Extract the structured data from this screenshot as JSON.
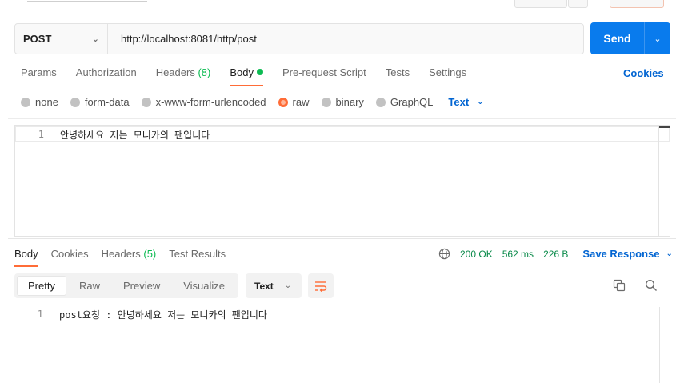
{
  "request": {
    "method": "POST",
    "url": "http://localhost:8081/http/post",
    "send_label": "Send"
  },
  "request_tabs": [
    {
      "label": "Params"
    },
    {
      "label": "Authorization"
    },
    {
      "label": "Headers",
      "count": "(8)"
    },
    {
      "label": "Body"
    },
    {
      "label": "Pre-request Script"
    },
    {
      "label": "Tests"
    },
    {
      "label": "Settings"
    }
  ],
  "cookies_link": "Cookies",
  "body_options": {
    "none": "none",
    "form_data": "form-data",
    "urlencoded": "x-www-form-urlencoded",
    "raw": "raw",
    "binary": "binary",
    "graphql": "GraphQL",
    "selected": "raw",
    "format": "Text"
  },
  "editor": {
    "line_number": "1",
    "content": "안녕하세요 저는 모니카의 팬입니다"
  },
  "response_tabs": {
    "body": "Body",
    "cookies": "Cookies",
    "headers": "Headers",
    "headers_count": "(5)",
    "test_results": "Test Results"
  },
  "response_meta": {
    "status": "200 OK",
    "time": "562 ms",
    "size": "226 B",
    "save_label": "Save Response"
  },
  "view_modes": {
    "pretty": "Pretty",
    "raw": "Raw",
    "preview": "Preview",
    "visualize": "Visualize",
    "format": "Text"
  },
  "response_body": {
    "line_number": "1",
    "content": "post요청 : 안녕하세요 저는 모니카의 팬입니다"
  },
  "colors": {
    "accent": "#ff6c37",
    "primary": "#097bed",
    "link": "#0265d2",
    "success": "#0cbb52"
  }
}
